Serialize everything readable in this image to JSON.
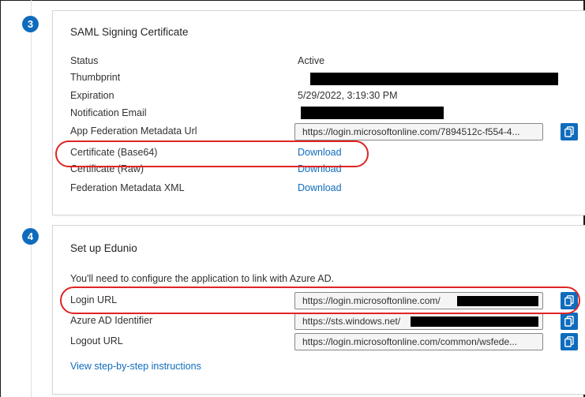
{
  "steps": {
    "three": "3",
    "four": "4"
  },
  "saml": {
    "title": "SAML Signing Certificate",
    "status_label": "Status",
    "status_value": "Active",
    "thumbprint_label": "Thumbprint",
    "expiration_label": "Expiration",
    "expiration_value": "5/29/2022, 3:19:30 PM",
    "notification_label": "Notification Email",
    "metadata_url_label": "App Federation Metadata Url",
    "metadata_url_value": "https://login.microsoftonline.com/7894512c-f554-4...",
    "cert_base64_label": "Certificate (Base64)",
    "cert_base64_link": "Download",
    "cert_raw_label": "Certificate (Raw)",
    "cert_raw_link": "Download",
    "fed_xml_label": "Federation Metadata XML",
    "fed_xml_link": "Download"
  },
  "setup": {
    "title": "Set up Edunio",
    "description": "You'll need to configure the application to link with Azure AD.",
    "login_label": "Login URL",
    "login_value": "https://login.microsoftonline.com/",
    "identifier_label": "Azure AD Identifier",
    "identifier_value": "https://sts.windows.net/",
    "logout_label": "Logout URL",
    "logout_value": "https://login.microsoftonline.com/common/wsfede...",
    "instructions_link": "View step-by-step instructions"
  },
  "colors": {
    "accent": "#0f6cbd",
    "annotation": "#e02424",
    "redaction": "#000000"
  },
  "icons": {
    "copy": "copy-icon"
  }
}
